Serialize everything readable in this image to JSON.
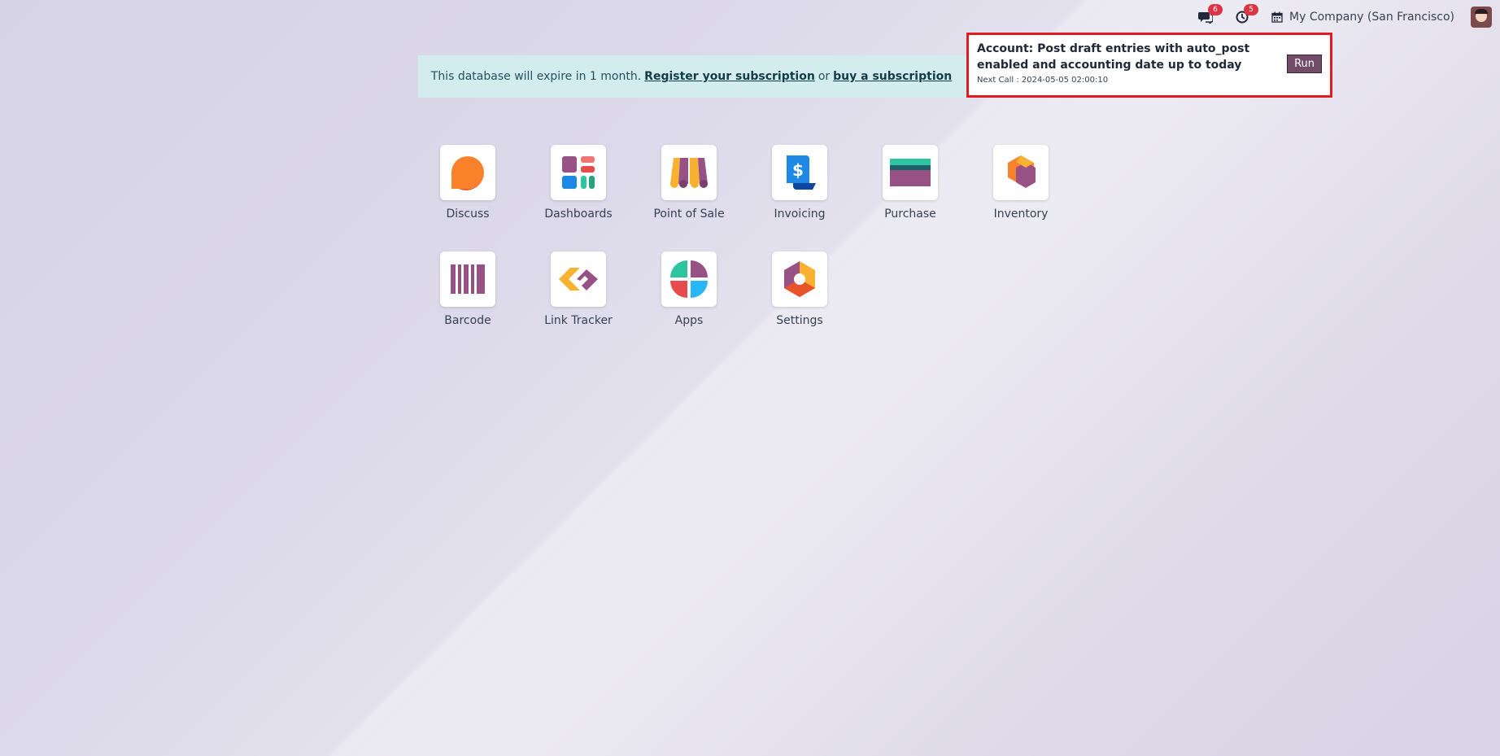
{
  "topbar": {
    "messages_badge": "6",
    "activities_badge": "5",
    "company": "My Company (San Francisco)"
  },
  "banner": {
    "text": "This database will expire in 1 month.",
    "register_link": "Register your subscription",
    "or_text": "or",
    "buy_link": "buy a subscription"
  },
  "popup": {
    "title": "Account: Post draft entries with auto_post enabled and accounting date up to today",
    "next_call": "Next Call : 2024-05-05 02:00:10",
    "run_label": "Run"
  },
  "apps": [
    {
      "label": "Discuss",
      "icon": "discuss-icon"
    },
    {
      "label": "Dashboards",
      "icon": "dashboards-icon"
    },
    {
      "label": "Point of Sale",
      "icon": "point-of-sale-icon"
    },
    {
      "label": "Invoicing",
      "icon": "invoicing-icon"
    },
    {
      "label": "Purchase",
      "icon": "purchase-icon"
    },
    {
      "label": "Inventory",
      "icon": "inventory-icon"
    },
    {
      "label": "Barcode",
      "icon": "barcode-icon"
    },
    {
      "label": "Link Tracker",
      "icon": "link-tracker-icon"
    },
    {
      "label": "Apps",
      "icon": "apps-icon"
    },
    {
      "label": "Settings",
      "icon": "settings-icon"
    }
  ],
  "colors": {
    "brand": "#714b67",
    "highlight_border": "#e01b24",
    "banner_bg": "#d3ecee",
    "badge": "#dc3545"
  }
}
